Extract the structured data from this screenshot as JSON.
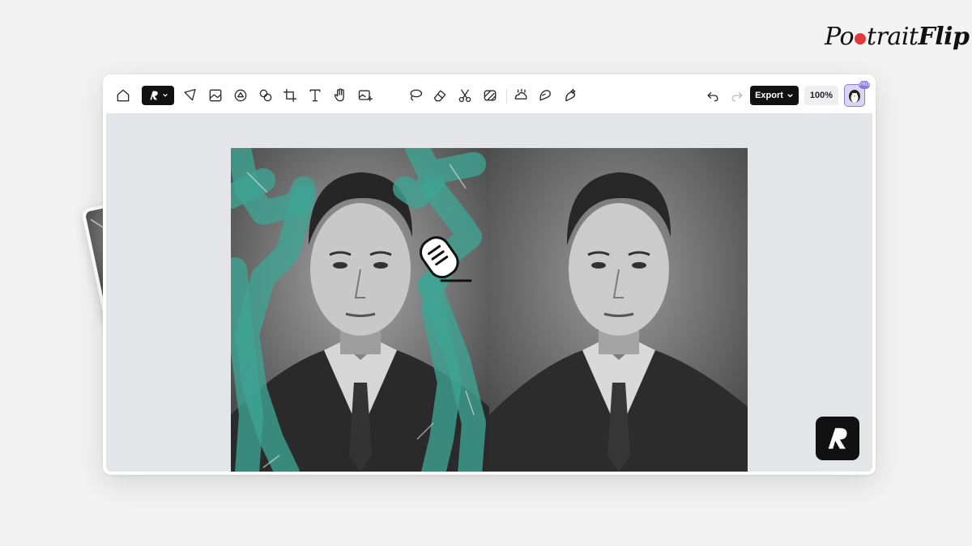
{
  "brand": {
    "name": "PortraitFlip"
  },
  "toolbar": {
    "tools_left": [
      "home-icon",
      "select-arrow-icon",
      "image-frame-icon",
      "shapes-icon",
      "layers-icon",
      "crop-icon",
      "text-tool-icon",
      "hand-pan-icon",
      "image-add-icon"
    ],
    "tools_center": [
      "lasso-icon",
      "eraser-icon",
      "scissors-icon",
      "remove-bg-icon",
      "retouch-icon",
      "magic-icon",
      "ai-brush-icon"
    ],
    "export_label": "Export",
    "zoom_level": "100%",
    "avatar_badge": "PRO"
  },
  "colors": {
    "accent_teal": "#5fb0a3",
    "brush_teal": "#3ea493",
    "toolbar_bg": "#ffffff",
    "canvas_bg": "#e4e5e9",
    "page_bg": "#f3f3f4",
    "brand_red": "#e0393e"
  }
}
